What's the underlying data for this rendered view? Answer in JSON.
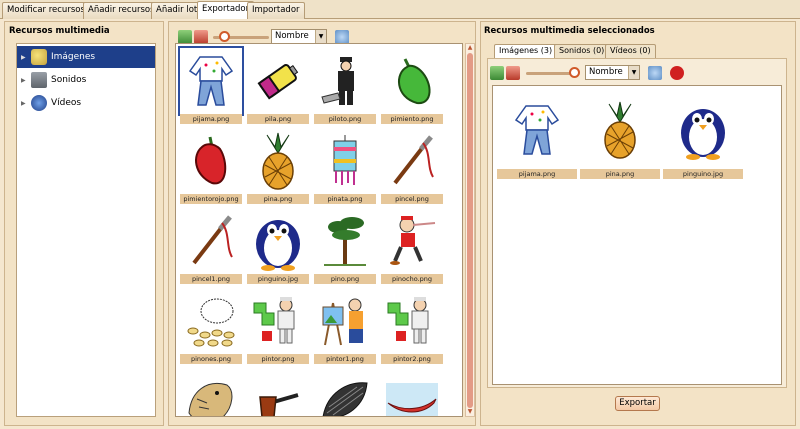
{
  "tabs": [
    "Modificar recursos",
    "Añadir recursos",
    "Añadir lote",
    "Exportador",
    "Importador"
  ],
  "active_tab": "Exportador",
  "left_panel": {
    "title": "Recursos multimedia",
    "items": [
      {
        "label": "Imágenes",
        "icon": "images-icon",
        "selected": true
      },
      {
        "label": "Sonidos",
        "icon": "speaker-icon",
        "selected": false
      },
      {
        "label": "Vídeos",
        "icon": "video-icon",
        "selected": false
      }
    ]
  },
  "center_toolbar": {
    "sort_select": "Nombre"
  },
  "gallery": [
    {
      "name": "pijama.png",
      "icon": "pajamas-icon"
    },
    {
      "name": "pila.png",
      "icon": "battery-icon"
    },
    {
      "name": "piloto.png",
      "icon": "pilot-icon"
    },
    {
      "name": "pimiento.png",
      "icon": "green-pepper-icon"
    },
    {
      "name": "pimientorojo.png",
      "icon": "red-pepper-icon"
    },
    {
      "name": "pina.png",
      "icon": "pineapple-icon"
    },
    {
      "name": "pinata.png",
      "icon": "pinata-icon"
    },
    {
      "name": "pincel.png",
      "icon": "brush-icon"
    },
    {
      "name": "pincel1.png",
      "icon": "brush-icon"
    },
    {
      "name": "pinguino.jpg",
      "icon": "penguin-icon"
    },
    {
      "name": "pino.png",
      "icon": "pine-tree-icon"
    },
    {
      "name": "pinocho.png",
      "icon": "pinocchio-icon"
    },
    {
      "name": "pinones.png",
      "icon": "pine-nuts-icon"
    },
    {
      "name": "pintor.png",
      "icon": "painter-icon"
    },
    {
      "name": "pintor1.png",
      "icon": "painter-easel-icon"
    },
    {
      "name": "pintor2.png",
      "icon": "painter-icon"
    },
    {
      "name": "",
      "icon": "animal-icon"
    },
    {
      "name": "",
      "icon": "pipe-icon"
    },
    {
      "name": "",
      "icon": "seed-icon"
    },
    {
      "name": "",
      "icon": "canoe-icon"
    }
  ],
  "right_panel": {
    "title": "Recursos multimedia seleccionados",
    "tabs": [
      "Imágenes (3)",
      "Sonidos (0)",
      "Vídeos (0)"
    ],
    "sort_select": "Nombre",
    "selected": [
      {
        "name": "pijama.png",
        "icon": "pajamas-icon"
      },
      {
        "name": "pina.png",
        "icon": "pineapple-icon"
      },
      {
        "name": "pinguino.jpg",
        "icon": "penguin-icon"
      }
    ]
  },
  "export_button": "Exportar"
}
